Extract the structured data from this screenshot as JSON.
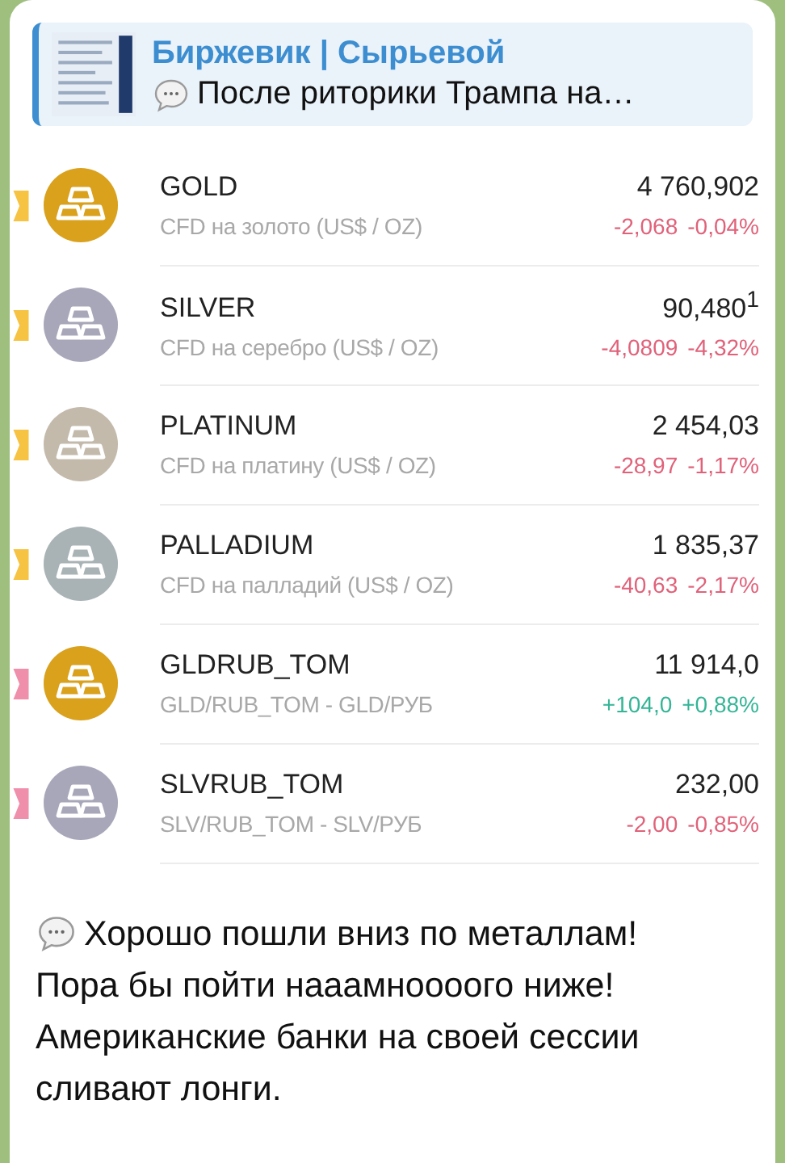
{
  "reply": {
    "title": "Биржевик | Сырьевой",
    "text": "После риторики Трампа на…"
  },
  "quotes": [
    {
      "name": "GOLD",
      "description": "CFD на золото (US$ / OZ)",
      "price": "4 760,902",
      "change": "-2,068",
      "change_percent": "-0,04%",
      "rising": false,
      "color": "#d9a11c",
      "flag": {
        "color": "#f6c343"
      }
    },
    {
      "name": "SILVER",
      "description": "CFD на серебро (US$ / OZ)",
      "price": "90,480$^{1}$",
      "change": "-4,0809",
      "change_percent": "-4,32%",
      "rising": false,
      "color": "#a8a7b9",
      "flag": {
        "color": "#f6c343"
      }
    },
    {
      "name": "PLATINUM",
      "description": "CFD на платину (US$ / OZ)",
      "price": "2 454,03",
      "change": "-28,97",
      "change_percent": "-1,17%",
      "rising": false,
      "color": "#c3baac",
      "flag": {
        "color": "#f6c343"
      }
    },
    {
      "name": "PALLADIUM",
      "description": "CFD на палладий (US$ / OZ)",
      "price": "1 835,37",
      "change": "-40,63",
      "change_percent": "-2,17%",
      "rising": false,
      "color": "#a9b2b4",
      "flag": {
        "color": "#f6c343"
      }
    },
    {
      "name": "GLDRUB_TOM",
      "description": "GLD/RUB_TOM - GLD/РУБ",
      "price": "11 914,0",
      "change": "+104,0",
      "change_percent": "+0,88%",
      "rising": true,
      "color": "#d9a11c",
      "flag": {
        "color": "#ef8fab"
      }
    },
    {
      "name": "SLVRUB_TOM",
      "description": "SLV/RUB_TOM - SLV/РУБ",
      "price": "232,00",
      "change": "-2,00",
      "change_percent": "-0,85%",
      "rising": false,
      "color": "#a8a7b9",
      "flag": {
        "color": "#ef8fab"
      }
    }
  ],
  "message": [
    "Хорошо пошли вниз по металлам!",
    "Пора бы пойти нааамноооого ниже!",
    "Американские банки на своей сессии сливают лонги."
  ]
}
